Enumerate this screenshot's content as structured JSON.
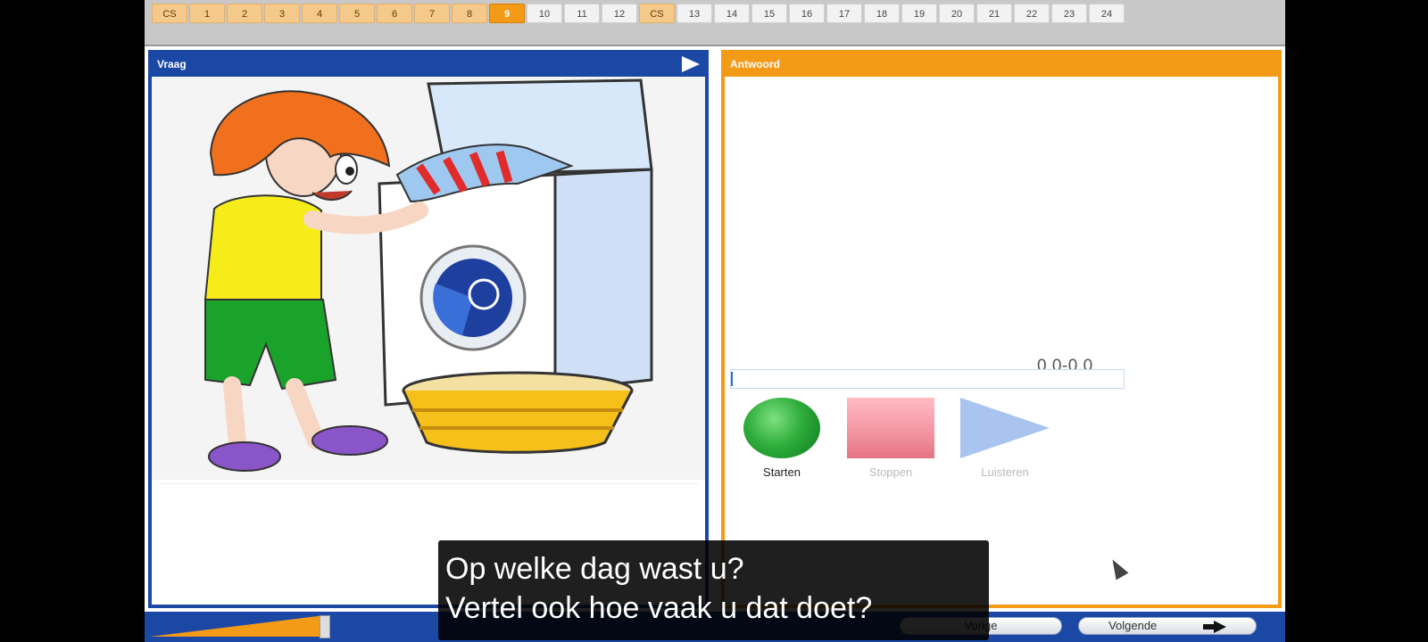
{
  "tabs": [
    {
      "label": "CS",
      "state": "done"
    },
    {
      "label": "1",
      "state": "done"
    },
    {
      "label": "2",
      "state": "done"
    },
    {
      "label": "3",
      "state": "done"
    },
    {
      "label": "4",
      "state": "done"
    },
    {
      "label": "5",
      "state": "done"
    },
    {
      "label": "6",
      "state": "done"
    },
    {
      "label": "7",
      "state": "done"
    },
    {
      "label": "8",
      "state": "done"
    },
    {
      "label": "9",
      "state": "current"
    },
    {
      "label": "10",
      "state": "todo"
    },
    {
      "label": "11",
      "state": "todo"
    },
    {
      "label": "12",
      "state": "todo"
    },
    {
      "label": "CS",
      "state": "done"
    },
    {
      "label": "13",
      "state": "todo"
    },
    {
      "label": "14",
      "state": "todo"
    },
    {
      "label": "15",
      "state": "todo"
    },
    {
      "label": "16",
      "state": "todo"
    },
    {
      "label": "17",
      "state": "todo"
    },
    {
      "label": "18",
      "state": "todo"
    },
    {
      "label": "19",
      "state": "todo"
    },
    {
      "label": "20",
      "state": "todo"
    },
    {
      "label": "21",
      "state": "todo"
    },
    {
      "label": "22",
      "state": "todo"
    },
    {
      "label": "23",
      "state": "todo"
    },
    {
      "label": "24",
      "state": "todo"
    }
  ],
  "question_panel": {
    "title": "Vraag"
  },
  "answer_panel": {
    "title": "Antwoord",
    "score": "0.0-0.0",
    "buttons": {
      "start": "Starten",
      "stop": "Stoppen",
      "listen": "Luisteren"
    }
  },
  "bottom": {
    "prev_label": "Vorige",
    "next_label": "Volgende"
  },
  "subtitles": {
    "line1": "Op welke dag wast u?",
    "line2": "Vertel ook hoe vaak u dat doet?"
  },
  "colors": {
    "question": "#1b47a5",
    "answer": "#f39a17",
    "current_tab": "#f39a17"
  }
}
